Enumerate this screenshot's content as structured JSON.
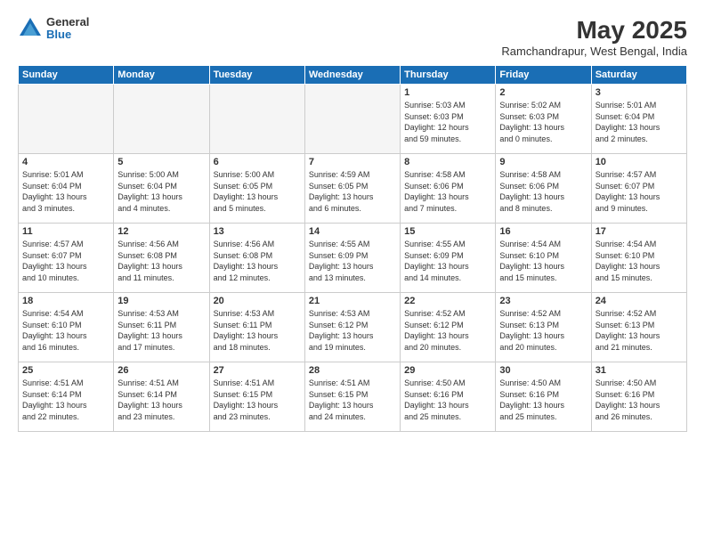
{
  "header": {
    "logo_general": "General",
    "logo_blue": "Blue",
    "month_title": "May 2025",
    "location": "Ramchandrapur, West Bengal, India"
  },
  "days_of_week": [
    "Sunday",
    "Monday",
    "Tuesday",
    "Wednesday",
    "Thursday",
    "Friday",
    "Saturday"
  ],
  "weeks": [
    [
      {
        "day": "",
        "info": ""
      },
      {
        "day": "",
        "info": ""
      },
      {
        "day": "",
        "info": ""
      },
      {
        "day": "",
        "info": ""
      },
      {
        "day": "1",
        "info": "Sunrise: 5:03 AM\nSunset: 6:03 PM\nDaylight: 12 hours\nand 59 minutes."
      },
      {
        "day": "2",
        "info": "Sunrise: 5:02 AM\nSunset: 6:03 PM\nDaylight: 13 hours\nand 0 minutes."
      },
      {
        "day": "3",
        "info": "Sunrise: 5:01 AM\nSunset: 6:04 PM\nDaylight: 13 hours\nand 2 minutes."
      }
    ],
    [
      {
        "day": "4",
        "info": "Sunrise: 5:01 AM\nSunset: 6:04 PM\nDaylight: 13 hours\nand 3 minutes."
      },
      {
        "day": "5",
        "info": "Sunrise: 5:00 AM\nSunset: 6:04 PM\nDaylight: 13 hours\nand 4 minutes."
      },
      {
        "day": "6",
        "info": "Sunrise: 5:00 AM\nSunset: 6:05 PM\nDaylight: 13 hours\nand 5 minutes."
      },
      {
        "day": "7",
        "info": "Sunrise: 4:59 AM\nSunset: 6:05 PM\nDaylight: 13 hours\nand 6 minutes."
      },
      {
        "day": "8",
        "info": "Sunrise: 4:58 AM\nSunset: 6:06 PM\nDaylight: 13 hours\nand 7 minutes."
      },
      {
        "day": "9",
        "info": "Sunrise: 4:58 AM\nSunset: 6:06 PM\nDaylight: 13 hours\nand 8 minutes."
      },
      {
        "day": "10",
        "info": "Sunrise: 4:57 AM\nSunset: 6:07 PM\nDaylight: 13 hours\nand 9 minutes."
      }
    ],
    [
      {
        "day": "11",
        "info": "Sunrise: 4:57 AM\nSunset: 6:07 PM\nDaylight: 13 hours\nand 10 minutes."
      },
      {
        "day": "12",
        "info": "Sunrise: 4:56 AM\nSunset: 6:08 PM\nDaylight: 13 hours\nand 11 minutes."
      },
      {
        "day": "13",
        "info": "Sunrise: 4:56 AM\nSunset: 6:08 PM\nDaylight: 13 hours\nand 12 minutes."
      },
      {
        "day": "14",
        "info": "Sunrise: 4:55 AM\nSunset: 6:09 PM\nDaylight: 13 hours\nand 13 minutes."
      },
      {
        "day": "15",
        "info": "Sunrise: 4:55 AM\nSunset: 6:09 PM\nDaylight: 13 hours\nand 14 minutes."
      },
      {
        "day": "16",
        "info": "Sunrise: 4:54 AM\nSunset: 6:10 PM\nDaylight: 13 hours\nand 15 minutes."
      },
      {
        "day": "17",
        "info": "Sunrise: 4:54 AM\nSunset: 6:10 PM\nDaylight: 13 hours\nand 15 minutes."
      }
    ],
    [
      {
        "day": "18",
        "info": "Sunrise: 4:54 AM\nSunset: 6:10 PM\nDaylight: 13 hours\nand 16 minutes."
      },
      {
        "day": "19",
        "info": "Sunrise: 4:53 AM\nSunset: 6:11 PM\nDaylight: 13 hours\nand 17 minutes."
      },
      {
        "day": "20",
        "info": "Sunrise: 4:53 AM\nSunset: 6:11 PM\nDaylight: 13 hours\nand 18 minutes."
      },
      {
        "day": "21",
        "info": "Sunrise: 4:53 AM\nSunset: 6:12 PM\nDaylight: 13 hours\nand 19 minutes."
      },
      {
        "day": "22",
        "info": "Sunrise: 4:52 AM\nSunset: 6:12 PM\nDaylight: 13 hours\nand 20 minutes."
      },
      {
        "day": "23",
        "info": "Sunrise: 4:52 AM\nSunset: 6:13 PM\nDaylight: 13 hours\nand 20 minutes."
      },
      {
        "day": "24",
        "info": "Sunrise: 4:52 AM\nSunset: 6:13 PM\nDaylight: 13 hours\nand 21 minutes."
      }
    ],
    [
      {
        "day": "25",
        "info": "Sunrise: 4:51 AM\nSunset: 6:14 PM\nDaylight: 13 hours\nand 22 minutes."
      },
      {
        "day": "26",
        "info": "Sunrise: 4:51 AM\nSunset: 6:14 PM\nDaylight: 13 hours\nand 23 minutes."
      },
      {
        "day": "27",
        "info": "Sunrise: 4:51 AM\nSunset: 6:15 PM\nDaylight: 13 hours\nand 23 minutes."
      },
      {
        "day": "28",
        "info": "Sunrise: 4:51 AM\nSunset: 6:15 PM\nDaylight: 13 hours\nand 24 minutes."
      },
      {
        "day": "29",
        "info": "Sunrise: 4:50 AM\nSunset: 6:16 PM\nDaylight: 13 hours\nand 25 minutes."
      },
      {
        "day": "30",
        "info": "Sunrise: 4:50 AM\nSunset: 6:16 PM\nDaylight: 13 hours\nand 25 minutes."
      },
      {
        "day": "31",
        "info": "Sunrise: 4:50 AM\nSunset: 6:16 PM\nDaylight: 13 hours\nand 26 minutes."
      }
    ]
  ]
}
